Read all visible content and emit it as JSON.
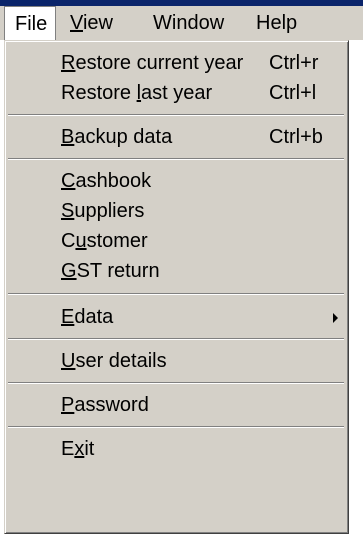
{
  "menubar": {
    "items": [
      {
        "label": "File",
        "mnemonic": "F"
      },
      {
        "label": "View",
        "mnemonic": "V"
      },
      {
        "label": "Window",
        "mnemonic": ""
      },
      {
        "label": "Help",
        "mnemonic": ""
      }
    ]
  },
  "file_menu": {
    "items": [
      {
        "pre": "",
        "mnemonic": "R",
        "post": "estore current year",
        "shortcut": "Ctrl+r"
      },
      {
        "pre": "Restore ",
        "mnemonic": "l",
        "post": "ast year",
        "shortcut": "Ctrl+l"
      },
      {
        "pre": "",
        "mnemonic": "B",
        "post": "ackup data",
        "shortcut": "Ctrl+b"
      },
      {
        "pre": "",
        "mnemonic": "C",
        "post": "ashbook",
        "shortcut": ""
      },
      {
        "pre": "",
        "mnemonic": "S",
        "post": "uppliers",
        "shortcut": ""
      },
      {
        "pre": "C",
        "mnemonic": "u",
        "post": "stomer",
        "shortcut": ""
      },
      {
        "pre": "",
        "mnemonic": "G",
        "post": "ST return",
        "shortcut": ""
      },
      {
        "pre": "",
        "mnemonic": "E",
        "post": "data",
        "shortcut": ""
      },
      {
        "pre": "",
        "mnemonic": "U",
        "post": "ser details",
        "shortcut": ""
      },
      {
        "pre": "",
        "mnemonic": "P",
        "post": "assword",
        "shortcut": ""
      },
      {
        "pre": "E",
        "mnemonic": "x",
        "post": "it",
        "shortcut": ""
      }
    ]
  },
  "colors": {
    "menu_face": "#d4d0c8",
    "title_strip": "#0a246a",
    "separator_dark": "#808080",
    "separator_light": "#ffffff"
  },
  "icons": {
    "submenu_arrow": "submenu-arrow-icon"
  }
}
